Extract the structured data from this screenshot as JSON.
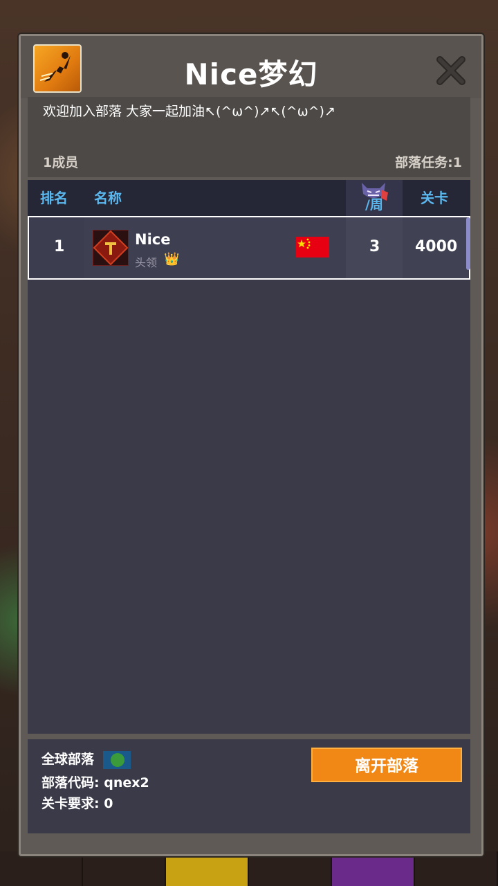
{
  "header": {
    "title": "Nice梦幻",
    "icon": "runner-icon"
  },
  "notice": "欢迎加入部落 大家一起加油↖(^ω^)↗↖(^ω^)↗",
  "stats": {
    "members": "1成员",
    "tasks": "部落任务:1"
  },
  "table": {
    "headers": {
      "rank": "排名",
      "name": "名称",
      "week": "/周",
      "level": "关卡"
    },
    "rows": [
      {
        "rank": "1",
        "name": "Nice",
        "role": "头领",
        "crown": "👑",
        "week": "3",
        "level": "4000",
        "flag": "china-flag"
      }
    ]
  },
  "footer": {
    "global": "全球部落",
    "code": "部落代码: qnex2",
    "requirement": "关卡要求:  0",
    "leave_label": "离开部落"
  },
  "colors": {
    "accent": "#f18714",
    "header_text": "#5bb8ee",
    "panel": "#3a3a49"
  }
}
